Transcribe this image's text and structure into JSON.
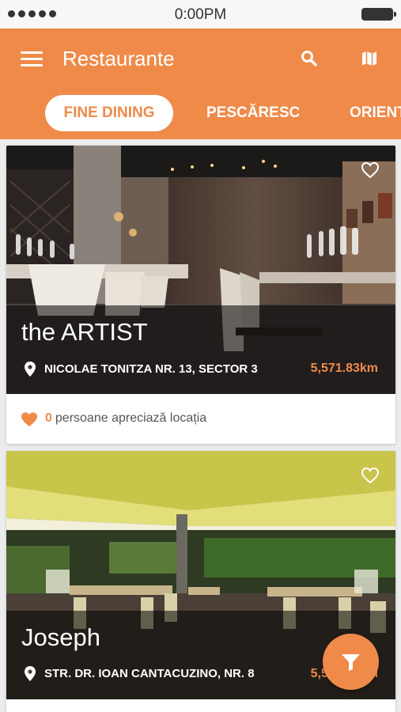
{
  "status_bar": {
    "time": "0:00PM"
  },
  "header": {
    "title": "Restaurante",
    "search_icon": "search-icon",
    "map_icon": "map-icon",
    "menu_icon": "menu-icon"
  },
  "tabs": [
    {
      "label": "FINE DINING",
      "active": true
    },
    {
      "label": "PESCĂRESC",
      "active": false
    },
    {
      "label": "ORIENT",
      "active": false
    }
  ],
  "restaurants": [
    {
      "name": "the ARTIST",
      "address": "NICOLAE TONITZA NR. 13, SECTOR 3",
      "distance": "5,571.83km",
      "likes_count": "0",
      "likes_text": "persoane apreciază locația"
    },
    {
      "name": "Joseph",
      "address": "STR. DR. IOAN CANTACUZINO, NR. 8",
      "distance": "5,571.83km"
    }
  ],
  "fab": {
    "icon": "filter-icon"
  },
  "colors": {
    "accent": "#ef8a49",
    "background": "#ececec"
  }
}
